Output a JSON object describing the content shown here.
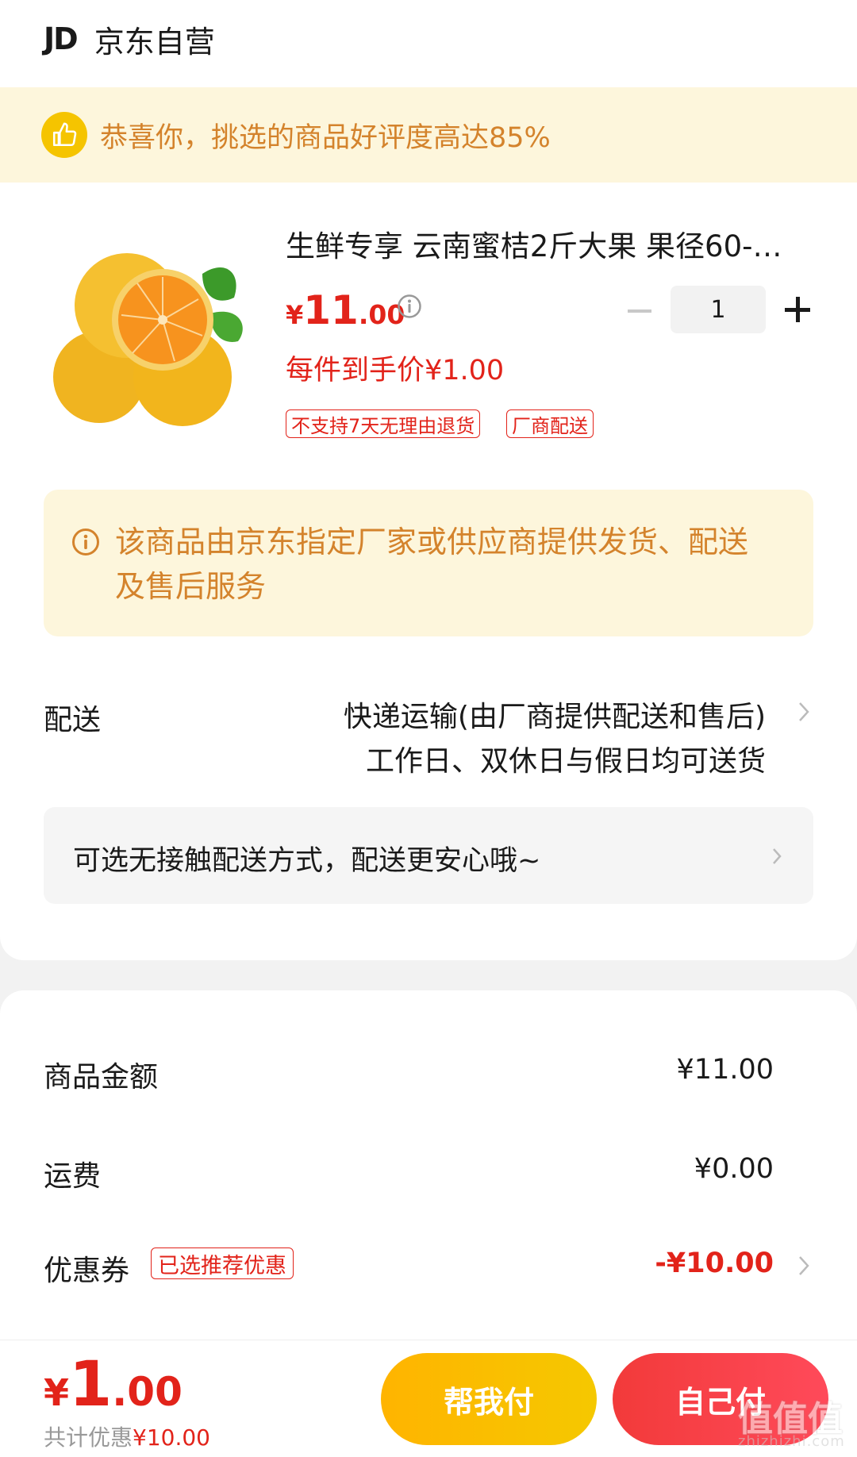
{
  "header": {
    "logo_text": "JD",
    "store_name": "京东自营"
  },
  "praise_banner": {
    "text": "恭喜你，挑选的商品好评度高达85%"
  },
  "product": {
    "image_icon": "orange-fruit-image",
    "title": "生鲜专享 云南蜜桔2斤大果 果径60-…",
    "price_currency": "¥",
    "price_integer": "11",
    "price_decimal": ".00",
    "unit_price_text": "每件到手价¥1.00",
    "quantity": "1",
    "tags": [
      "不支持7天无理由退货",
      "厂商配送"
    ]
  },
  "notice": {
    "text": "该商品由京东指定厂家或供应商提供发货、配送及售后服务"
  },
  "delivery": {
    "label": "配送",
    "line1": "快递运输(由厂商提供配送和售后)",
    "line2": "工作日、双休日与假日均可送货",
    "contactless_text": "可选无接触配送方式，配送更安心哦~"
  },
  "summary": {
    "goods_label": "商品金额",
    "goods_value": "¥11.00",
    "shipping_label": "运费",
    "shipping_value": "¥0.00",
    "coupon_label": "优惠券",
    "coupon_tag": "已选推荐优惠",
    "coupon_value": "-¥10.00"
  },
  "bottom_bar": {
    "total_currency": "¥",
    "total_integer": "1",
    "total_decimal": ".00",
    "discount_prefix": "共计优惠",
    "discount_amount": "¥10.00",
    "help_pay_label": "帮我付",
    "self_pay_label": "自己付"
  },
  "watermark": {
    "text": "值值值",
    "sub": "zhizhizhi.com"
  },
  "colors": {
    "brand_red": "#e2231a",
    "banner_bg": "#fdf6dc",
    "banner_text": "#d4832c",
    "help_button": "#ffb400",
    "self_button": "#f23a3a"
  }
}
